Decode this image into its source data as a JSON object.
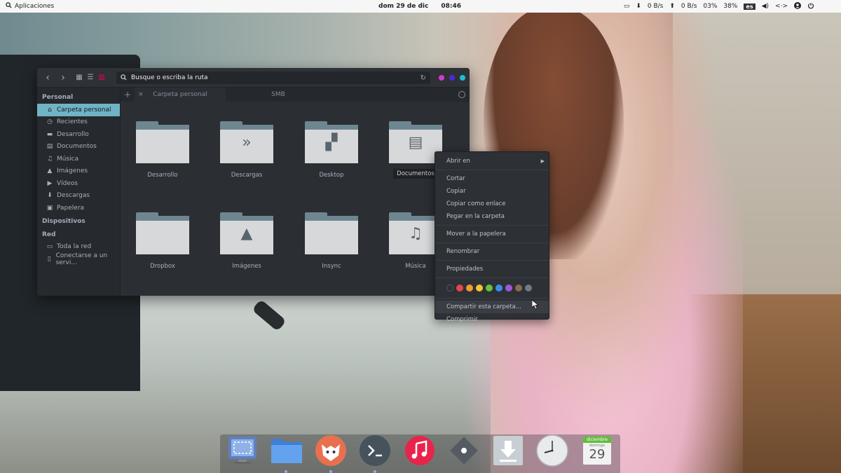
{
  "top_panel": {
    "apps_label": "Aplicaciones",
    "date": "dom 29 de dic",
    "time": "08:46",
    "download_speed": "0 B/s",
    "upload_speed": "0 B/s",
    "volume": "03%",
    "battery": "38%",
    "lang": "es"
  },
  "file_manager": {
    "path_placeholder": "Busque o escriba la ruta",
    "sidebar": {
      "personal": "Personal",
      "personal_items": [
        "Carpeta personal",
        "Recientes",
        "Desarrollo",
        "Documentos",
        "Música",
        "Imágenes",
        "Vídeos",
        "Descargas",
        "Papelera"
      ],
      "devices": "Dispositivos",
      "network": "Red",
      "network_items": [
        "Toda la red",
        "Conectarse a un servi..."
      ]
    },
    "tabs": [
      "Carpeta personal",
      "SMB"
    ],
    "folders": [
      "Desarrollo",
      "Descargas",
      "Desktop",
      "Documentos",
      "Dropbox",
      "Imágenes",
      "Insync",
      "Música"
    ]
  },
  "context_menu": {
    "items": [
      "Abrir en",
      "Cortar",
      "Copiar",
      "Copiar como enlace",
      "Pegar en la carpeta",
      "Mover a la papelera",
      "Renombrar",
      "Propiedades",
      "Compartir esta carpeta...",
      "Comprimir"
    ],
    "swatch_colors": [
      "#e8454b",
      "#f39a32",
      "#f2c530",
      "#67c23a",
      "#3b8ee8",
      "#9b59d9",
      "#8c6a50",
      "#6c7a86"
    ]
  },
  "dock": {
    "calendar_month": "diciembre",
    "calendar_weekday": "domingo",
    "calendar_day": "29"
  },
  "colors": {
    "accent": "#6fb3c5",
    "window_bg": "#2b2e33",
    "dot_pink": "#d23ad0",
    "dot_purple": "#4b2ad6",
    "dot_cyan": "#20c0d0"
  }
}
